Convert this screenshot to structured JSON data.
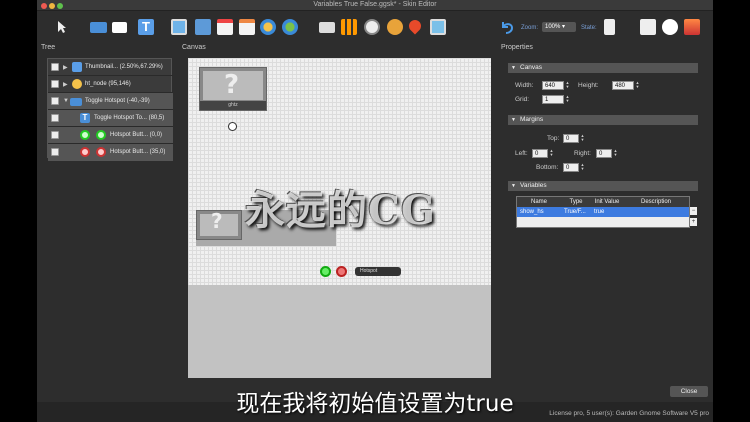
{
  "window": {
    "title": "Variables True False.ggsk* - Skin Editor"
  },
  "toolbar": {
    "zoom_label": "Zoom:",
    "zoom_value": "100%",
    "state_label": "State:"
  },
  "panels": {
    "tree": "Tree",
    "canvas": "Canvas",
    "properties": "Properties"
  },
  "tree": {
    "items": [
      {
        "label": "Thumbnail... (2.50%,67.29%)"
      },
      {
        "label": "ht_node (95,146)"
      },
      {
        "label": "Toggle Hotspot (-40,-39)"
      },
      {
        "label": "Toggle Hotspot To... (80,5)"
      },
      {
        "label": "Hotspot Butt... (0,0)"
      },
      {
        "label": "Hotspot Butt... (35,0)"
      }
    ]
  },
  "canvas": {
    "thumb_caption": "ghtz",
    "hotspot_label": "Hotspot"
  },
  "properties": {
    "canvas_section": "Canvas",
    "width_label": "Width:",
    "width_value": "640",
    "height_label": "Height:",
    "height_value": "480",
    "grid_label": "Grid:",
    "grid_value": "1",
    "margins_section": "Margins",
    "top_label": "Top:",
    "top_value": "0",
    "left_label": "Left:",
    "left_value": "0",
    "right_label": "Right:",
    "right_value": "0",
    "bottom_label": "Bottom:",
    "bottom_value": "0",
    "variables_section": "Variables",
    "table_headers": [
      "Name",
      "Type",
      "Init Value",
      "Description"
    ],
    "rows": [
      {
        "name": "show_hs",
        "type": "True/F...",
        "init": "true",
        "desc": ""
      }
    ]
  },
  "footer": {
    "close_label": "Close",
    "license": "License pro, 5 user(s): Garden Gnome Software V5 pro"
  },
  "overlay": {
    "watermark": "永远的CG",
    "subtitle": "现在我将初始值设置为true"
  }
}
